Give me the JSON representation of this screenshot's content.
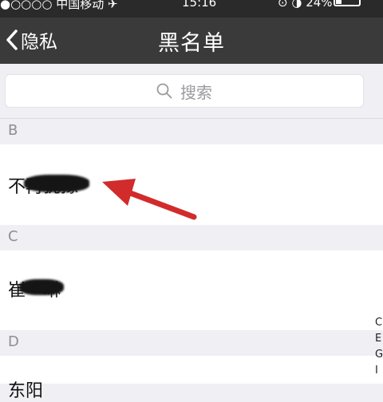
{
  "status_bar": {
    "carrier": "●○○○○ 中国移动 ✈",
    "time": "15:16",
    "battery_text": "⊙ ◑ 24%"
  },
  "nav": {
    "back_label": "隐私",
    "title": "黑名单"
  },
  "search": {
    "placeholder": "搜索"
  },
  "sections": [
    {
      "letter": "B",
      "contacts": [
        {
          "name": "不再犹豫"
        }
      ]
    },
    {
      "letter": "C",
      "contacts": [
        {
          "name": "崔　琳"
        }
      ]
    },
    {
      "letter": "D",
      "contacts": [
        {
          "name": "东阳"
        }
      ]
    }
  ],
  "index_letters": [
    "C",
    "E",
    "G",
    "I"
  ],
  "colors": {
    "nav_bg": "#3a3a3a",
    "arrow": "#d12b2b",
    "page_bg": "#efeff4"
  },
  "icons": {
    "back": "chevron-left-icon",
    "search": "search-icon"
  }
}
